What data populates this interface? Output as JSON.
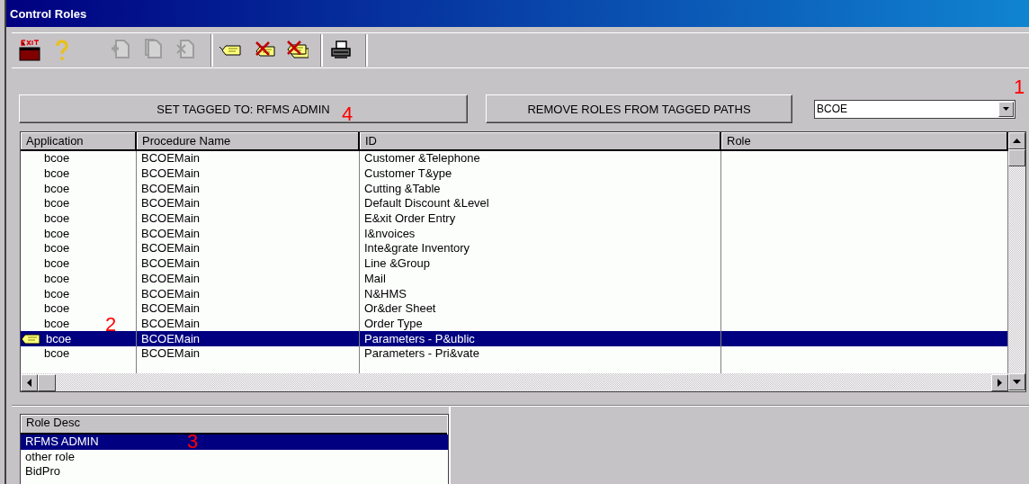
{
  "window": {
    "title": "Control Roles"
  },
  "toolbar": [
    {
      "items": [
        {
          "kind": "exit",
          "disabled": false
        },
        {
          "kind": "help",
          "disabled": false
        },
        {
          "kind": "add",
          "disabled": true
        },
        {
          "kind": "copy",
          "disabled": true
        },
        {
          "kind": "delete",
          "disabled": true
        }
      ]
    },
    {
      "items": [
        {
          "kind": "tag",
          "disabled": false
        },
        {
          "kind": "untag",
          "disabled": false
        },
        {
          "kind": "untag-all",
          "disabled": false
        }
      ]
    },
    {
      "items": [
        {
          "kind": "print",
          "disabled": false
        }
      ]
    }
  ],
  "buttons": [
    "SET TAGGED TO: RFMS ADMIN",
    "REMOVE ROLES FROM TAGGED PATHS"
  ],
  "application_select": {
    "value": "BCOE"
  },
  "table": {
    "columns": [
      "Application",
      "Procedure Name",
      "ID",
      "Role"
    ],
    "rows": [
      {
        "cells": [
          "bcoe",
          "BCOEMain",
          "Customer &Telephone"
        ],
        "selected": false,
        "tagged": false
      },
      {
        "cells": [
          "bcoe",
          "BCOEMain",
          "Customer T&ype"
        ],
        "selected": false,
        "tagged": false
      },
      {
        "cells": [
          "bcoe",
          "BCOEMain",
          "Cutting &Table"
        ],
        "selected": false,
        "tagged": false
      },
      {
        "cells": [
          "bcoe",
          "BCOEMain",
          "Default Discount &Level"
        ],
        "selected": false,
        "tagged": false
      },
      {
        "cells": [
          "bcoe",
          "BCOEMain",
          "E&xit Order Entry"
        ],
        "selected": false,
        "tagged": false
      },
      {
        "cells": [
          "bcoe",
          "BCOEMain",
          "I&nvoices"
        ],
        "selected": false,
        "tagged": false
      },
      {
        "cells": [
          "bcoe",
          "BCOEMain",
          "Inte&grate Inventory"
        ],
        "selected": false,
        "tagged": false
      },
      {
        "cells": [
          "bcoe",
          "BCOEMain",
          "Line &Group"
        ],
        "selected": false,
        "tagged": false
      },
      {
        "cells": [
          "bcoe",
          "BCOEMain",
          "Mail"
        ],
        "selected": false,
        "tagged": false
      },
      {
        "cells": [
          "bcoe",
          "BCOEMain",
          "N&HMS"
        ],
        "selected": false,
        "tagged": false
      },
      {
        "cells": [
          "bcoe",
          "BCOEMain",
          "Or&der Sheet"
        ],
        "selected": false,
        "tagged": false
      },
      {
        "cells": [
          "bcoe",
          "BCOEMain",
          "Order Type"
        ],
        "selected": false,
        "tagged": false
      },
      {
        "cells": [
          "bcoe",
          "BCOEMain",
          "Parameters - P&ublic"
        ],
        "selected": true,
        "tagged": true
      },
      {
        "cells": [
          "bcoe",
          "BCOEMain",
          "Parameters - Pri&vate"
        ],
        "selected": false,
        "tagged": false
      }
    ]
  },
  "roles": {
    "column": "Role Desc",
    "items": [
      {
        "label": "RFMS ADMIN",
        "selected": true
      },
      {
        "label": "other role",
        "selected": false
      },
      {
        "label": "BidPro",
        "selected": false
      }
    ]
  },
  "callouts": [
    "1",
    "2",
    "3",
    "4"
  ]
}
